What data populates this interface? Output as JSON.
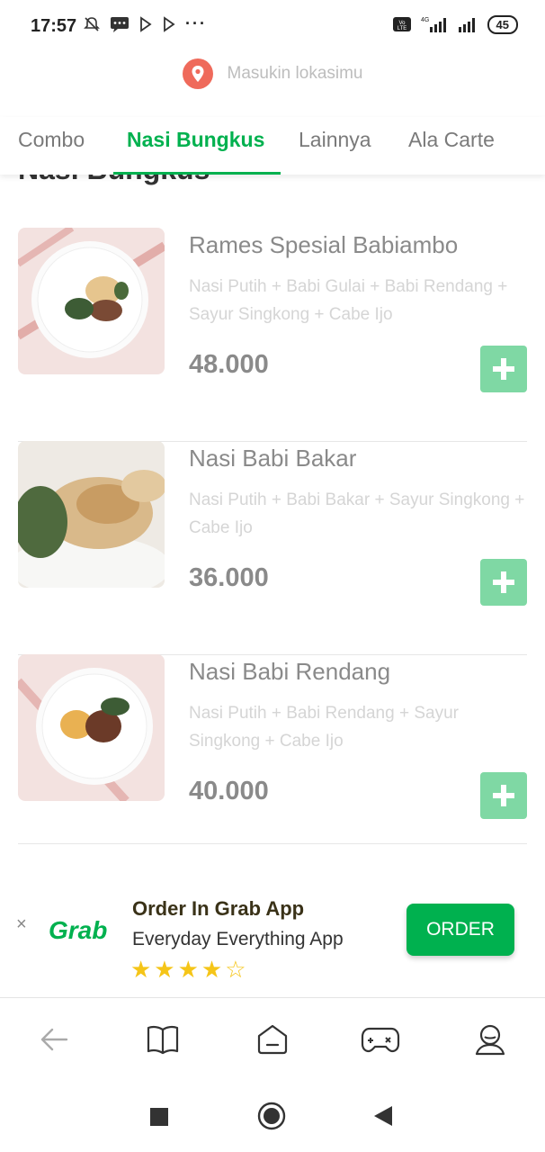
{
  "status_bar": {
    "time": "17:57",
    "battery": "45",
    "network": "4G"
  },
  "location": {
    "placeholder": "Masukin lokasimu",
    "icon": "location-pin-icon"
  },
  "tabs": [
    {
      "label": "Combo",
      "active": false
    },
    {
      "label": "Nasi Bungkus",
      "active": true
    },
    {
      "label": "Lainnya",
      "active": false
    },
    {
      "label": "Ala Carte",
      "active": false
    }
  ],
  "section_title": "Nasi Bungkus",
  "menu_items": [
    {
      "name": "Rames Spesial Babiambo",
      "description": "Nasi Putih + Babi Gulai + Babi Rendang + Sayur Singkong + Cabe Ijo",
      "price": "48.000"
    },
    {
      "name": "Nasi Babi Bakar",
      "description": "Nasi Putih + Babi Bakar + Sayur Singkong + Cabe Ijo",
      "price": "36.000"
    },
    {
      "name": "Nasi Babi Rendang",
      "description": "Nasi Putih + Babi Rendang + Sayur Singkong + Cabe Ijo",
      "price": "40.000"
    }
  ],
  "banner": {
    "close": "×",
    "logo": "Grab",
    "title": "Order In Grab App",
    "subtitle": "Everyday Everything App",
    "stars": "★★★★☆",
    "rating": 4.5,
    "cta": "ORDER"
  },
  "bottom_nav": [
    "back-arrow-icon",
    "book-icon",
    "home-icon",
    "gamepad-icon",
    "profile-icon"
  ],
  "colors": {
    "accent": "#00b14f",
    "add_button": "#7fd8a4",
    "pin": "#ef6a5b",
    "star": "#f5c518"
  }
}
